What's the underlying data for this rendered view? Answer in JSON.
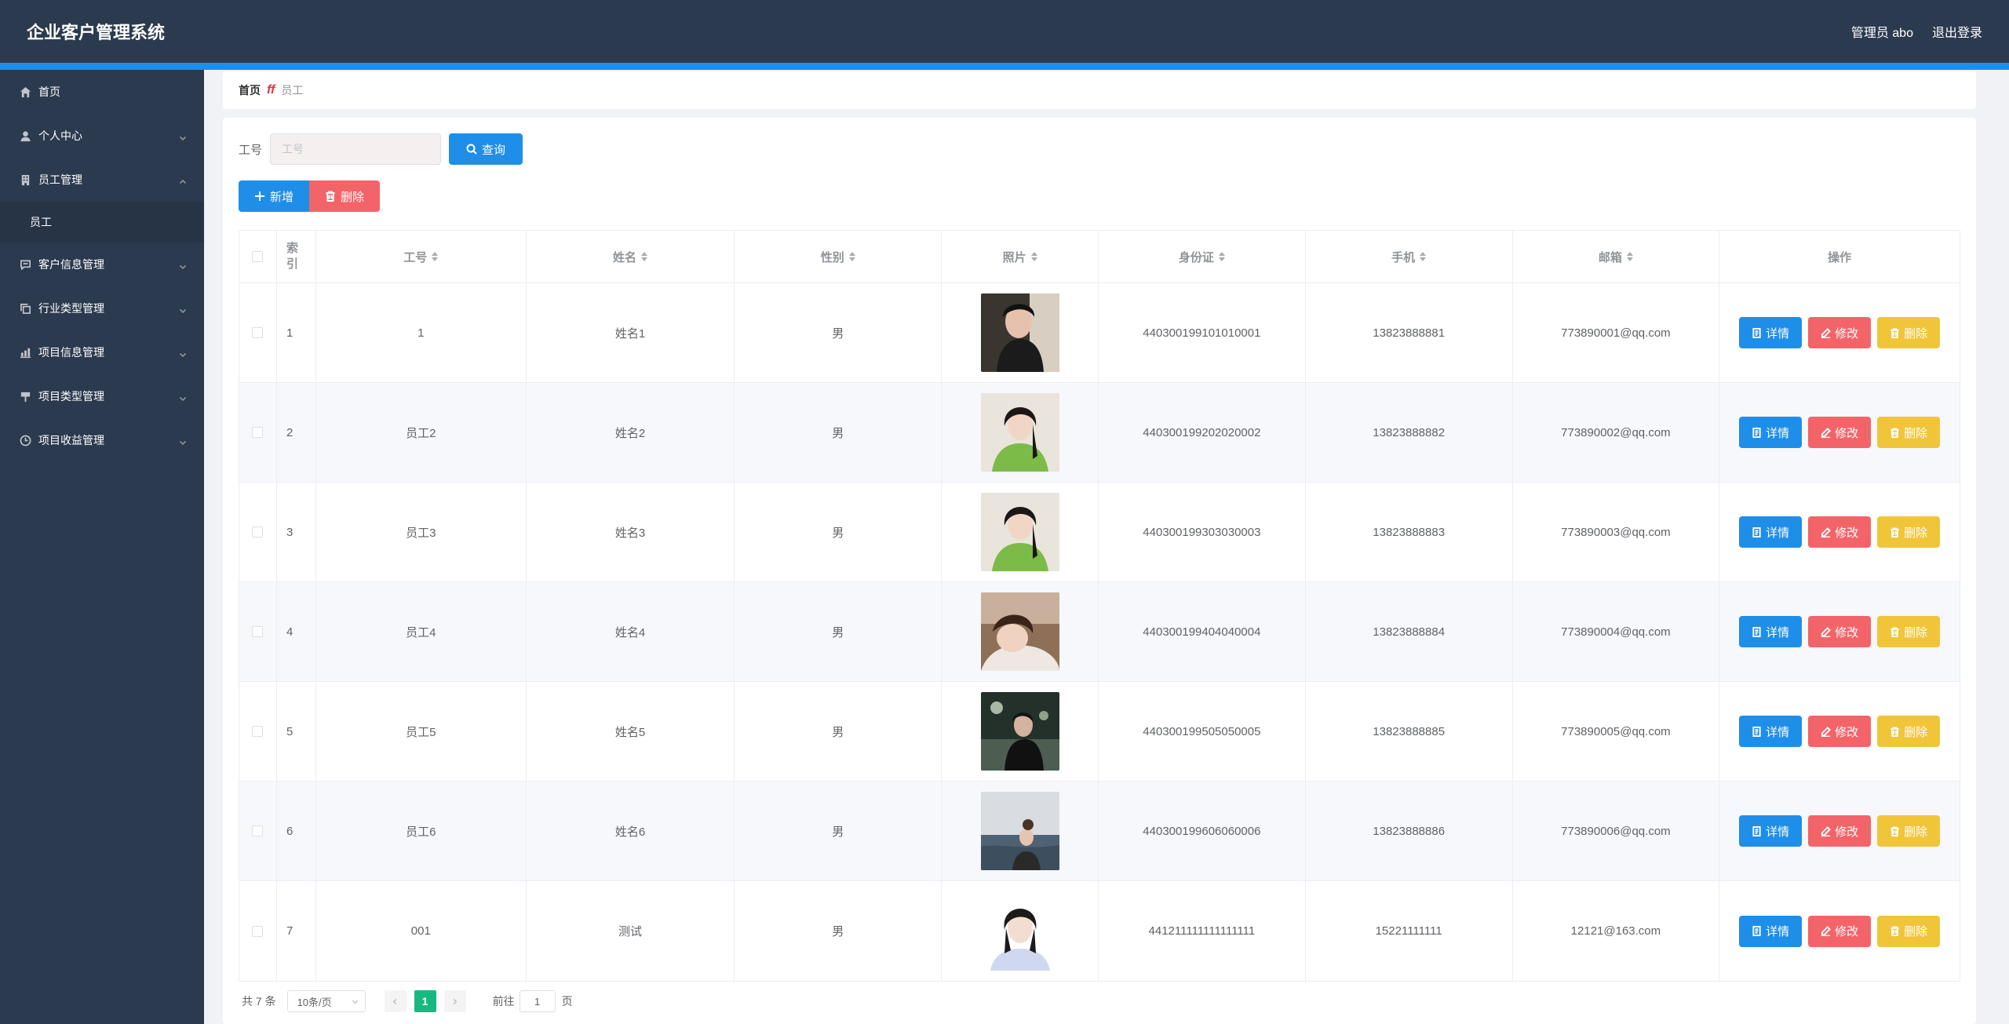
{
  "header": {
    "title": "企业客户管理系统",
    "user": "管理员 abo",
    "logout": "退出登录"
  },
  "colors": {
    "header_bg": "#2c3a4f",
    "accent_bar": "#1e8ee9",
    "primary": "#1e8ee9",
    "danger": "#f36469",
    "warning": "#f1c53a",
    "success": "#17b981"
  },
  "sidebar": {
    "items": [
      {
        "label": "首页",
        "icon": "home-icon"
      },
      {
        "label": "个人中心",
        "icon": "user-icon"
      },
      {
        "label": "员工管理",
        "icon": "building-icon"
      },
      {
        "label": "客户信息管理",
        "icon": "chat-icon"
      },
      {
        "label": "行业类型管理",
        "icon": "copy-icon"
      },
      {
        "label": "项目信息管理",
        "icon": "chart-icon"
      },
      {
        "label": "项目类型管理",
        "icon": "flag-icon"
      },
      {
        "label": "项目收益管理",
        "icon": "clock-icon"
      }
    ],
    "sub_item": "员工"
  },
  "breadcrumb": {
    "home": "首页",
    "separator": "ff",
    "current": "员工"
  },
  "search": {
    "label": "工号",
    "placeholder": "工号",
    "value": "",
    "button": "查询"
  },
  "actions": {
    "add": "新增",
    "delete": "删除"
  },
  "table": {
    "columns": {
      "index": "索引",
      "no": "工号",
      "name": "姓名",
      "sex": "性别",
      "photo": "照片",
      "idcard": "身份证",
      "phone": "手机",
      "email": "邮箱",
      "ops": "操作"
    },
    "rows": [
      {
        "index": "1",
        "no": "1",
        "name": "姓名1",
        "sex": "男",
        "idcard": "440300199101010001",
        "phone": "13823888881",
        "email": "773890001@qq.com"
      },
      {
        "index": "2",
        "no": "员工2",
        "name": "姓名2",
        "sex": "男",
        "idcard": "440300199202020002",
        "phone": "13823888882",
        "email": "773890002@qq.com"
      },
      {
        "index": "3",
        "no": "员工3",
        "name": "姓名3",
        "sex": "男",
        "idcard": "440300199303030003",
        "phone": "13823888883",
        "email": "773890003@qq.com"
      },
      {
        "index": "4",
        "no": "员工4",
        "name": "姓名4",
        "sex": "男",
        "idcard": "440300199404040004",
        "phone": "13823888884",
        "email": "773890004@qq.com"
      },
      {
        "index": "5",
        "no": "员工5",
        "name": "姓名5",
        "sex": "男",
        "idcard": "440300199505050005",
        "phone": "13823888885",
        "email": "773890005@qq.com"
      },
      {
        "index": "6",
        "no": "员工6",
        "name": "姓名6",
        "sex": "男",
        "idcard": "440300199606060006",
        "phone": "13823888886",
        "email": "773890006@qq.com"
      },
      {
        "index": "7",
        "no": "001",
        "name": "测试",
        "sex": "男",
        "idcard": "441211111111111111",
        "phone": "15221111111",
        "email": "12121@163.com"
      }
    ],
    "ops": {
      "detail": "详情",
      "edit": "修改",
      "delete": "删除"
    }
  },
  "pagination": {
    "total": "共 7 条",
    "page_size": "10条/页",
    "current_page": "1",
    "goto_prefix": "前往",
    "goto_value": "1",
    "goto_suffix": "页"
  }
}
